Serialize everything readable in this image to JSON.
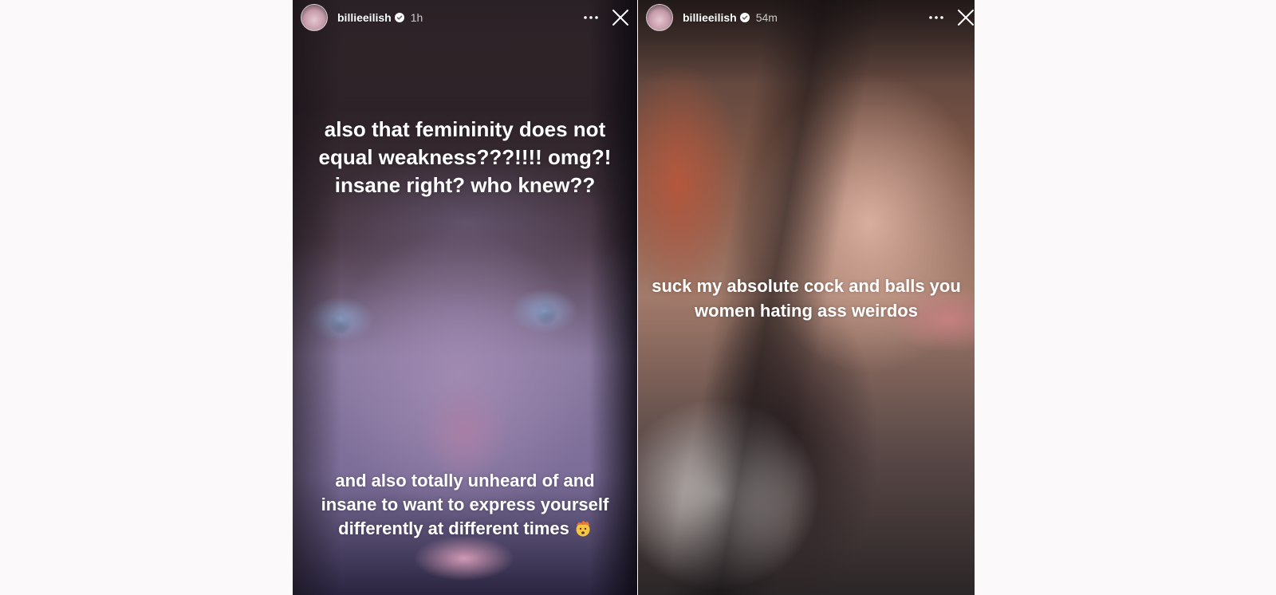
{
  "stories": [
    {
      "username": "billieeilish",
      "time_ago": "1h",
      "caption_top": "also that femininity does not equal weakness???!!!! omg?! insane right? who knew??",
      "caption_bottom": "and also totally unheard of and insane to want to express yourself differently at different times",
      "emoji_icon": "exploding-head-emoji"
    },
    {
      "username": "billieeilish",
      "time_ago": "54m",
      "caption": "suck my absolute cock and balls you women hating ass weirdos"
    }
  ],
  "icons": {
    "verified": "verified-badge-icon",
    "more": "more-options-icon",
    "close": "close-icon"
  },
  "colors": {
    "page_background": "#fbf9f9",
    "text": "#ffffff"
  }
}
